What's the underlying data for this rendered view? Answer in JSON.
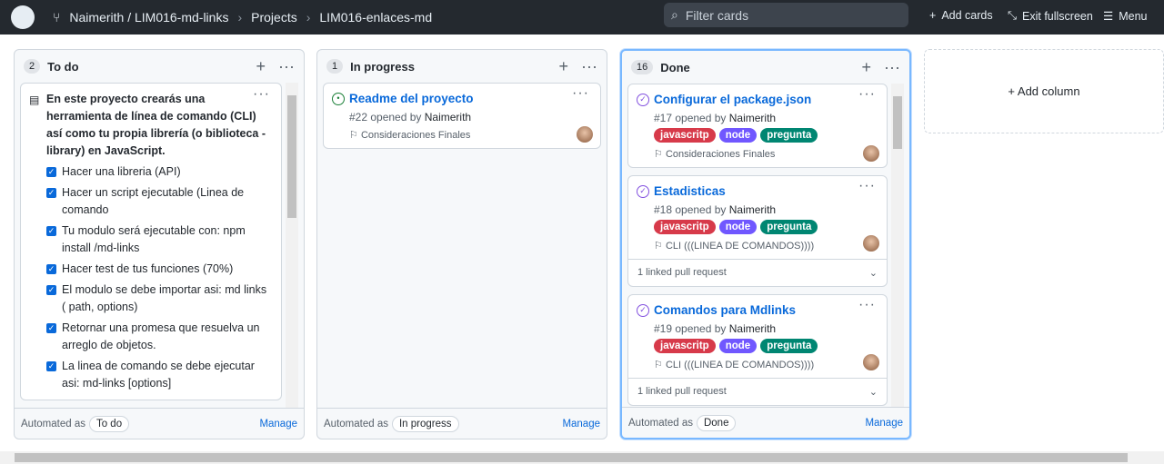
{
  "header": {
    "breadcrumb": [
      "Naimerith / LIM016-md-links",
      "Projects",
      "LIM016-enlaces-md"
    ],
    "search_placeholder": "Filter cards",
    "add_cards": "Add cards",
    "exit_fullscreen": "Exit fullscreen",
    "menu": "Menu"
  },
  "columns": [
    {
      "name": "To do",
      "count": "2",
      "automated_label": "Automated as",
      "automated_value": "To do",
      "manage": "Manage",
      "note": {
        "title": "En este proyecto crearás una herramienta de línea de comando (CLI) así como tu propia librería (o biblioteca - library) en JavaScript.",
        "items": [
          "Hacer una libreria (API)",
          "Hacer un script ejecutable (Linea de comando",
          "Tu modulo será ejecutable con: npm install /md-links",
          "Hacer test de tus funciones (70%)",
          "El modulo se debe importar asi: md links ( path, options)",
          "Retornar una promesa que resuelva un arreglo de objetos.",
          "La linea de comando se debe ejecutar asi: md-links [options]"
        ]
      }
    },
    {
      "name": "In progress",
      "count": "1",
      "automated_label": "Automated as",
      "automated_value": "In progress",
      "manage": "Manage",
      "cards": [
        {
          "title": "Readme del proyecto",
          "meta": "#22 opened by",
          "author": "Naimerith",
          "milestone": "Consideraciones Finales",
          "state": "open"
        }
      ]
    },
    {
      "name": "Done",
      "count": "16",
      "automated_label": "Automated as",
      "automated_value": "Done",
      "manage": "Manage",
      "cards": [
        {
          "title": "Configurar el package.json",
          "meta": "#17 opened by",
          "author": "Naimerith",
          "labels": [
            "javascritp",
            "node",
            "pregunta"
          ],
          "milestone": "Consideraciones Finales",
          "state": "closed"
        },
        {
          "title": "Estadisticas",
          "meta": "#18 opened by",
          "author": "Naimerith",
          "labels": [
            "javascritp",
            "node",
            "pregunta"
          ],
          "milestone": "CLI (((LINEA DE COMANDOS))))",
          "linked": "1 linked pull request",
          "state": "closed"
        },
        {
          "title": "Comandos para Mdlinks",
          "meta": "#19 opened by",
          "author": "Naimerith",
          "labels": [
            "javascritp",
            "node",
            "pregunta"
          ],
          "milestone": "CLI (((LINEA DE COMANDOS))))",
          "linked": "1 linked pull request",
          "state": "closed"
        }
      ]
    }
  ],
  "add_column": "+ Add column",
  "label_colors": {
    "javascritp": "#d73a4a",
    "node": "#7057ff",
    "pregunta": "#008672"
  },
  "state_colors": {
    "open": "#1a7f37",
    "closed": "#8250df"
  }
}
